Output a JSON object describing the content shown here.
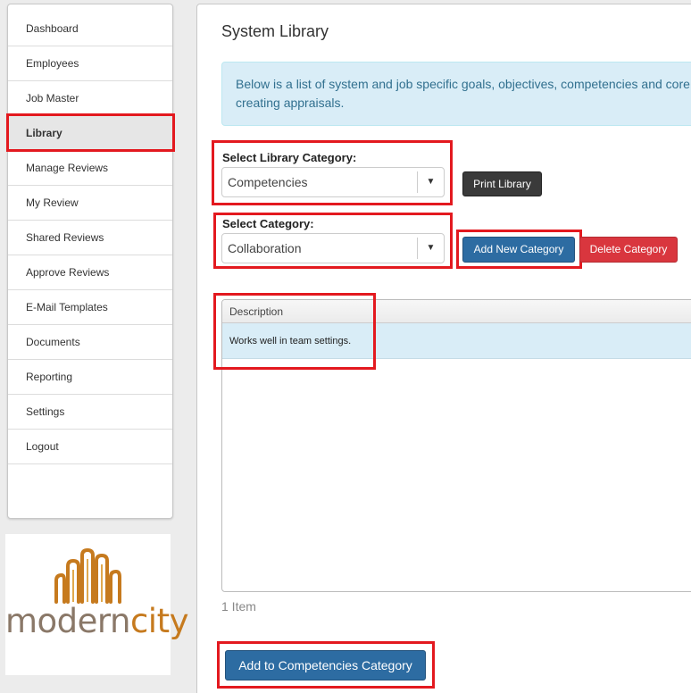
{
  "sidebar": {
    "items": [
      {
        "label": "Dashboard",
        "active": false
      },
      {
        "label": "Employees",
        "active": false
      },
      {
        "label": "Job Master",
        "active": false
      },
      {
        "label": "Library",
        "active": true
      },
      {
        "label": "Manage Reviews",
        "active": false
      },
      {
        "label": "My Review",
        "active": false
      },
      {
        "label": "Shared Reviews",
        "active": false
      },
      {
        "label": "Approve Reviews",
        "active": false
      },
      {
        "label": "E-Mail Templates",
        "active": false
      },
      {
        "label": "Documents",
        "active": false
      },
      {
        "label": "Reporting",
        "active": false
      },
      {
        "label": "Settings",
        "active": false
      },
      {
        "label": "Logout",
        "active": false
      }
    ]
  },
  "logo": {
    "part1": "modern",
    "part2": "city"
  },
  "main": {
    "title": "System Library",
    "info_text_line1": "Below is a list of system and job specific goals, objectives, competencies and core",
    "info_text_line2": "creating appraisals.",
    "library_category_label": "Select Library Category:",
    "library_category_value": "Competencies",
    "print_label": "Print Library",
    "category_label": "Select Category:",
    "category_value": "Collaboration",
    "add_category_label": "Add New Category",
    "delete_category_label": "Delete Category",
    "grid": {
      "header": "Description",
      "rows": [
        "Works well in team settings."
      ]
    },
    "item_count": "1 Item",
    "add_to_category_label": "Add to Competencies Category"
  },
  "colors": {
    "highlight": "#e3191f",
    "primary_button": "#2d6ca2",
    "danger_button": "#d9363e",
    "info_background": "#d9edf7"
  }
}
